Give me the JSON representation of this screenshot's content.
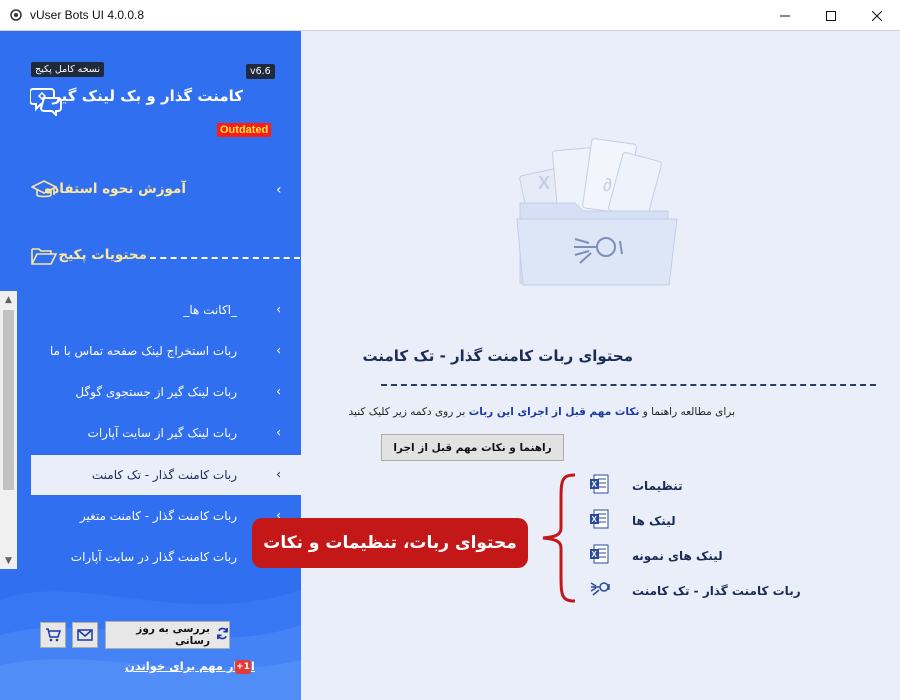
{
  "window": {
    "title": "vUser Bots UI 4.0.0.8",
    "controls": [
      "minimize",
      "maximize",
      "close"
    ]
  },
  "sidebar": {
    "package_badge": "نسخه کامل پکیج",
    "version_badge": "v6.6",
    "app_name": "کامنت گذار و بک لینک گیر",
    "status_badge": "Outdated",
    "tutorial_label": "آموزش نحوه استفاده",
    "contents_label": "محتویات پکیج",
    "menu_items": [
      {
        "label": "_اکانت ها_"
      },
      {
        "label": "ربات استخراج لینک صفحه تماس با ما"
      },
      {
        "label": "ربات لینک گیر از جستجوی گوگل"
      },
      {
        "label": "ربات لینک گیر از سایت آپارات"
      },
      {
        "label": "ربات کامنت گذار - تک کامنت"
      },
      {
        "label": "ربات کامنت گذار - کامنت متغیر"
      },
      {
        "label": "ربات کامنت گذار در سایت آپارات"
      }
    ],
    "active_index": 4,
    "update_button": "بررسی به روز رسانی",
    "news_link": "اخبار مهم برای خواندن",
    "news_count": "+1"
  },
  "main": {
    "title": "محتوای ربات کامنت گذار - تک کامنت",
    "description_prefix": "برای مطالعه راهنما و",
    "description_bold": "نکات مهم قبل از اجرای این ربات",
    "description_suffix": "بر روی دکمه زیر کلیک کنید",
    "guide_button": "راهنما و نکات مهم قبل از اجرا",
    "files": [
      {
        "label": "تنظیمات",
        "icon": "excel-icon"
      },
      {
        "label": "لینک ها",
        "icon": "excel-icon"
      },
      {
        "label": "لینک های نمونه",
        "icon": "excel-icon"
      },
      {
        "label": "ربات کامنت گذار - تک کامنت",
        "icon": "robot-icon"
      }
    ],
    "callout": "محتوای ربات، تنظیمات و نکات"
  },
  "colors": {
    "sidebar_bg": "#2f6ff0",
    "main_bg": "#e9eef8",
    "callout_bg": "#c41818",
    "brace": "#c41818",
    "outdated_bg": "#ff1a1a",
    "outdated_text": "#ffeb3b"
  }
}
